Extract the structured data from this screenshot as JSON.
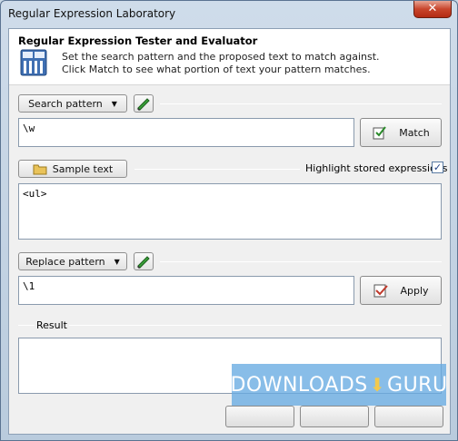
{
  "window": {
    "title": "Regular Expression Laboratory",
    "close_glyph": "✕"
  },
  "header": {
    "title": "Regular Expression Tester and Evaluator",
    "desc_line1": "Set the search pattern and the proposed text to match against.",
    "desc_line2": "Click Match to see what portion of text your pattern matches."
  },
  "search": {
    "button_label": "Search pattern",
    "value": "\\w",
    "match_label": "Match"
  },
  "sample": {
    "button_label": "Sample text",
    "value": "<ul>",
    "highlight_label": "Highlight stored expressions",
    "highlight_checked": true,
    "check_glyph": "✓"
  },
  "replace": {
    "button_label": "Replace pattern",
    "value": "\\1",
    "apply_label": "Apply"
  },
  "result": {
    "label": "Result",
    "value": ""
  },
  "watermark": {
    "text_left": "DOWNLOADS",
    "text_right": "GURU"
  },
  "icons": {
    "chevron": "▼",
    "pencil": "pencil-icon",
    "folder": "folder-icon"
  }
}
